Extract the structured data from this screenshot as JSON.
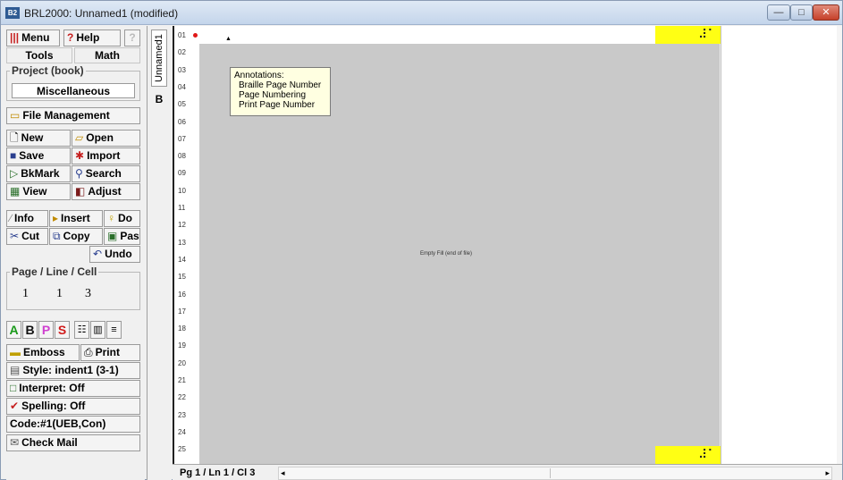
{
  "window": {
    "title": "BRL2000: Unnamed1  (modified)",
    "app_icon_text": "B2",
    "minimize_symbol": "—",
    "maximize_symbol": "□",
    "close_symbol": "✕"
  },
  "toolbar": {
    "menu": "Menu",
    "help": "Help",
    "help_extra": "?",
    "tools_tab": "Tools",
    "math_tab": "Math"
  },
  "project": {
    "label": "Project (book)",
    "value": "Miscellaneous"
  },
  "buttons": {
    "file_management": "File Management",
    "new": "New",
    "open": "Open",
    "save": "Save",
    "import": "Import",
    "bkmark": "BkMark",
    "search": "Search",
    "view": "View",
    "adjust": "Adjust",
    "info": "Info",
    "insert": "Insert",
    "do": "Do",
    "cut": "Cut",
    "copy": "Copy",
    "paste": "Paste",
    "undo": "Undo",
    "emboss": "Emboss",
    "print": "Print",
    "style": "Style: indent1 (3-1)",
    "interpret": "Interpret: Off",
    "spelling": "Spelling: Off",
    "code": "Code:#1(UEB,Con)",
    "check_mail": "Check Mail"
  },
  "format_buttons": {
    "a": "A",
    "b": "B",
    "p": "P",
    "s": "S"
  },
  "page_line_cell": {
    "label": "Page / Line / Cell",
    "page": "1",
    "line": "1",
    "cell": "3"
  },
  "doc_tab": {
    "name": "Unnamed1",
    "grade_button": "B"
  },
  "editor": {
    "line_numbers": [
      "01",
      "02",
      "03",
      "04",
      "05",
      "06",
      "07",
      "08",
      "09",
      "10",
      "11",
      "12",
      "13",
      "14",
      "15",
      "16",
      "17",
      "18",
      "19",
      "20",
      "21",
      "22",
      "23",
      "24",
      "25"
    ],
    "cursor_mark": "▲",
    "braille_top": "⠼⠁",
    "braille_bottom": "⠼⠁",
    "annotation_title": "Annotations:",
    "annotations": [
      "Braille Page Number",
      "Page Numbering",
      "Print Page Number"
    ],
    "center_text": "Empty Fill (end of file)"
  },
  "status": {
    "position_text": "Pg 1 / Ln 1 / Cl 3",
    "scroll_left": "◂",
    "scroll_right": "▸"
  },
  "colors": {
    "braille_highlight": "#ffff14",
    "editor_bg": "#c9c9c9",
    "annotation_bg": "#ffffe1"
  }
}
